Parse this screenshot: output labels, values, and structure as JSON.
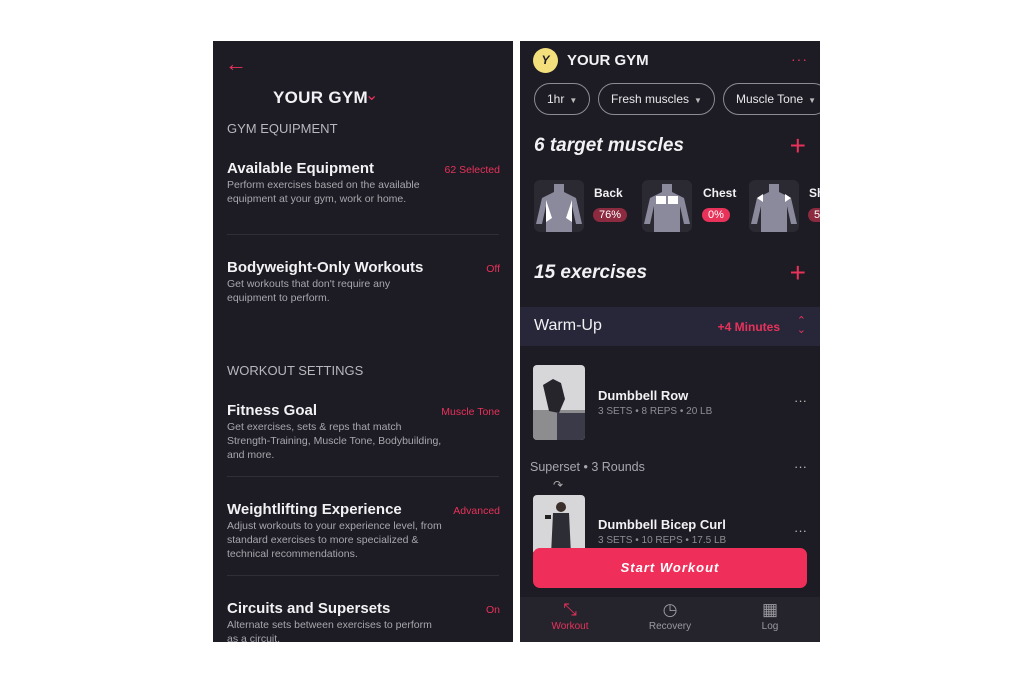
{
  "left": {
    "back_icon": "arrow-left",
    "gym_title": "YOUR GYM",
    "section_equipment": "GYM EQUIPMENT",
    "section_workout": "WORKOUT SETTINGS",
    "settings": [
      {
        "title": "Available Equipment",
        "desc": "Perform exercises based on the available equipment at your gym, work or home.",
        "value": "62 Selected"
      },
      {
        "title": "Bodyweight-Only Workouts",
        "desc": "Get workouts that don't require any equipment to perform.",
        "value": "Off"
      },
      {
        "title": "Fitness Goal",
        "desc": "Get exercises, sets & reps that match Strength-Training, Muscle Tone, Bodybuilding, and more.",
        "value": "Muscle Tone"
      },
      {
        "title": "Weightlifting Experience",
        "desc": "Adjust workouts to your experience level, from standard exercises to more specialized & technical recommendations.",
        "value": "Advanced"
      },
      {
        "title": "Circuits and Supersets",
        "desc": "Alternate sets between exercises to perform as a circuit.",
        "value": "On"
      }
    ]
  },
  "right": {
    "avatar_letter": "Y",
    "title": "YOUR GYM",
    "filters": [
      "1hr",
      "Fresh muscles",
      "Muscle Tone"
    ],
    "target_heading": "6 target muscles",
    "muscles": [
      {
        "name": "Back",
        "pct": "76%"
      },
      {
        "name": "Chest",
        "pct": "0%"
      },
      {
        "name": "Sh",
        "pct": "5"
      }
    ],
    "exercises_heading": "15 exercises",
    "warmup_label": "Warm-Up",
    "warmup_value": "+4 Minutes",
    "exercises": [
      {
        "name": "Dumbbell Row",
        "meta": "3 SETS • 8 REPS • 20 LB"
      },
      {
        "name": "Dumbbell Bicep Curl",
        "meta": "3 SETS • 10 REPS • 17.5 LB"
      }
    ],
    "superset_label": "Superset",
    "superset_rounds": "3 Rounds",
    "start_button": "Start Workout",
    "nav": [
      {
        "label": "Workout",
        "icon": "arrows-expand",
        "active": true
      },
      {
        "label": "Recovery",
        "icon": "clock-refresh"
      },
      {
        "label": "Log",
        "icon": "calendar"
      }
    ]
  },
  "colors": {
    "accent": "#e8325a",
    "background": "#1d1b23",
    "avatar": "#f3e07c"
  }
}
